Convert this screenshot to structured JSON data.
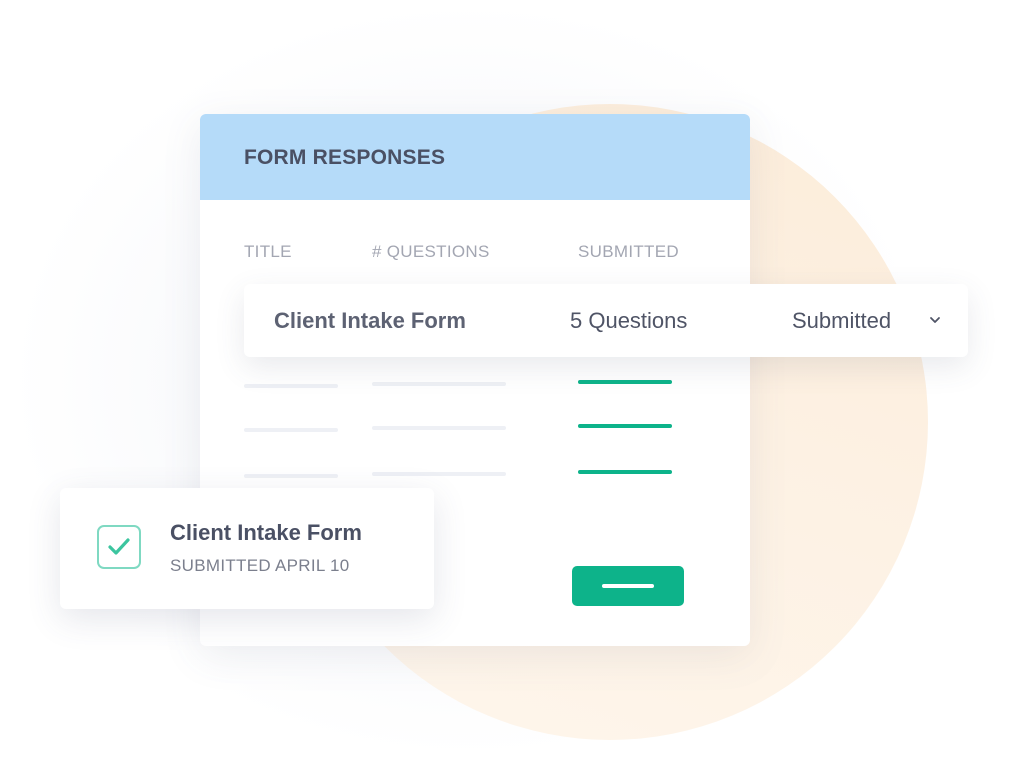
{
  "form_responses": {
    "title": "FORM RESPONSES",
    "columns": [
      "TITLE",
      "# QUESTIONS",
      "SUBMITTED"
    ],
    "highlighted_row": {
      "title": "Client Intake Form",
      "questions": "5 Questions",
      "status": "Submitted",
      "status_icon": "chevron-down-icon"
    },
    "placeholder_rows": 3
  },
  "confirmation": {
    "title": "Client Intake Form",
    "subtitle": "SUBMITTED APRIL 10",
    "icon": "checkbox-checked-icon"
  },
  "colors": {
    "header_bg": "#b5dbf9",
    "accent_green": "#0db38a",
    "check_border": "#7fd9c2",
    "backdrop_circle": "#fdf1e3"
  }
}
